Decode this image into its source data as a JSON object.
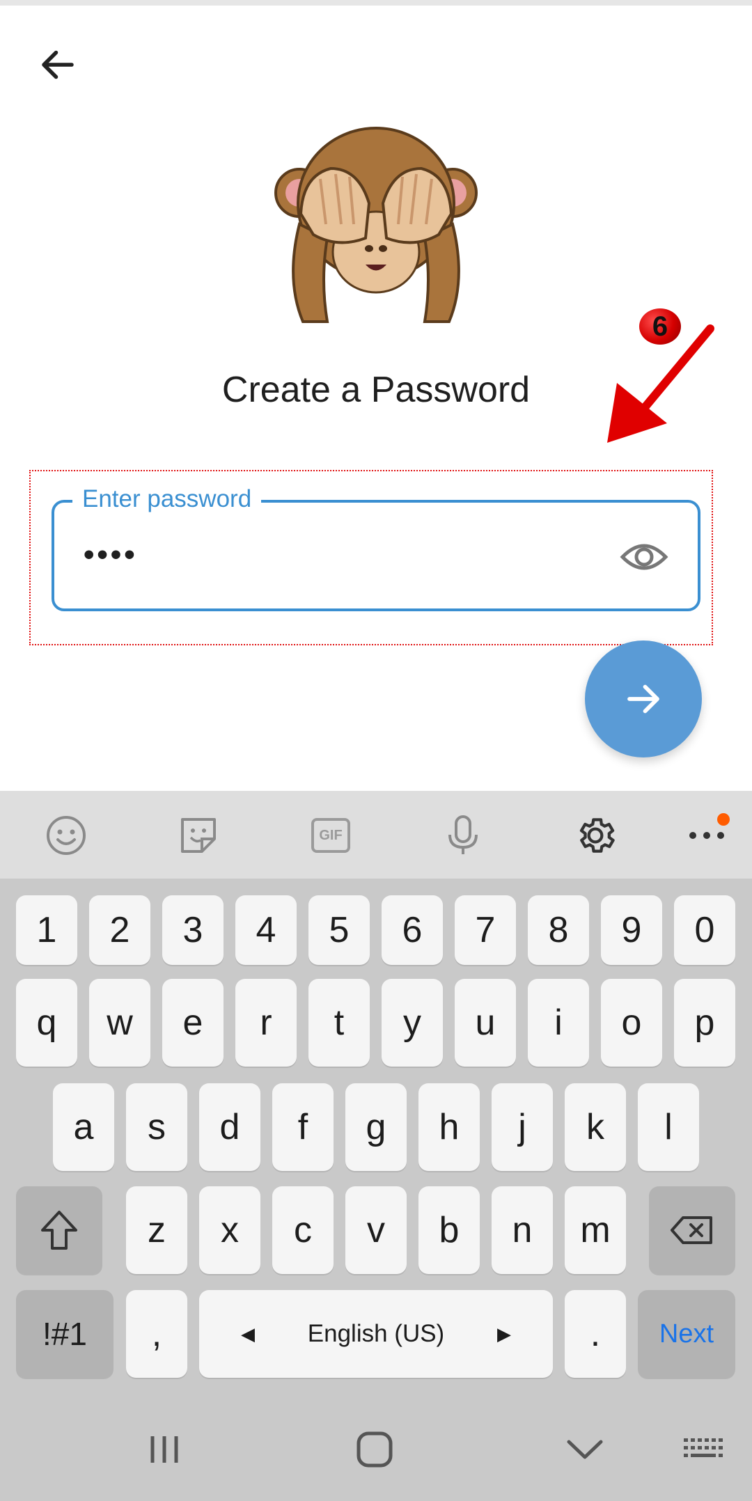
{
  "page": {
    "title": "Create a Password"
  },
  "password_field": {
    "label": "Enter password",
    "value": "••••"
  },
  "annotation": {
    "step": "6",
    "color": "#e01010"
  },
  "colors": {
    "accent": "#3a8fd1",
    "fab": "#5a9bd6",
    "keyboard_bg": "#c9c9c9",
    "next_key_text": "#1a73e8"
  },
  "icons": {
    "back": "arrow-left-icon",
    "visibility": "eye-icon",
    "next_fab": "arrow-right-icon",
    "emoji": "smiley-icon",
    "sticker": "sticker-icon",
    "gif": "gif-icon",
    "mic": "microphone-icon",
    "settings": "gear-icon",
    "more": "more-dots-icon",
    "shift": "shift-arrow-icon",
    "backspace": "backspace-icon"
  },
  "keyboard": {
    "gif_label": "GIF",
    "number_row": [
      "1",
      "2",
      "3",
      "4",
      "5",
      "6",
      "7",
      "8",
      "9",
      "0"
    ],
    "row1": [
      "q",
      "w",
      "e",
      "r",
      "t",
      "y",
      "u",
      "i",
      "o",
      "p"
    ],
    "row2": [
      "a",
      "s",
      "d",
      "f",
      "g",
      "h",
      "j",
      "k",
      "l"
    ],
    "row3": [
      "z",
      "x",
      "c",
      "v",
      "b",
      "n",
      "m"
    ],
    "symbols_label": "!#1",
    "comma_label": ",",
    "space_label": "English (US)",
    "period_label": ".",
    "next_label": "Next"
  },
  "navbar": {
    "recents": "recents-icon",
    "home": "home-icon",
    "back": "nav-back-chevron-icon",
    "keyboard": "keyboard-switch-icon"
  }
}
